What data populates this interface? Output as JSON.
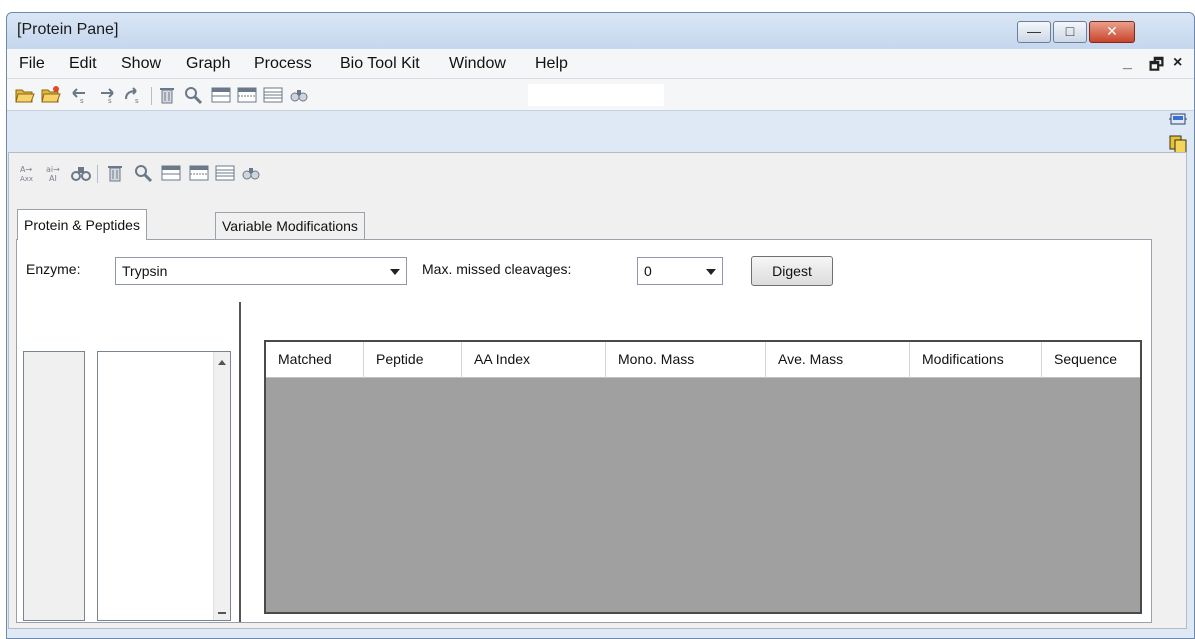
{
  "window": {
    "title": "[Protein Pane]",
    "controls": [
      "minimize",
      "maximize",
      "close"
    ]
  },
  "menubar": {
    "items": [
      "File",
      "Edit",
      "Show",
      "Graph",
      "Process",
      "Bio Tool Kit",
      "Window",
      "Help"
    ],
    "mdi_controls": [
      "_",
      "🗗",
      "×"
    ]
  },
  "toolbar": {
    "icons": [
      "open-folder-icon",
      "open-folder-star-icon",
      "undo-icon",
      "redo-icon",
      "redo-all-icon",
      "trash-icon",
      "magnify-icon",
      "table-icon",
      "table-icon",
      "table-lines-icon",
      "binoculars-icon"
    ],
    "search_value": ""
  },
  "pane_toolbar": {
    "icons": [
      "aa-arrow-icon",
      "ai-arrow-icon",
      "binoculars-icon",
      "trash-icon",
      "magnify-icon",
      "table-icon",
      "table-icon",
      "table-lines-icon",
      "binoculars-small-icon"
    ]
  },
  "tabs": {
    "protein_peptides": "Protein & Peptides",
    "variable_mods": "Variable Modifications"
  },
  "digest": {
    "enzyme_label": "Enzyme:",
    "enzyme_value": "Trypsin",
    "missed_label": "Max. missed cleavages:",
    "missed_value": "0",
    "digest_button": "Digest"
  },
  "table": {
    "columns": [
      "Matched",
      "Peptide",
      "AA Index",
      "Mono. Mass",
      "Ave. Mass",
      "Modifications",
      "Sequence"
    ],
    "rows": []
  },
  "colors": {
    "grid_background": "#a0a0a0",
    "window_frame": "#dfe9f5",
    "close_button": "#c8452c"
  }
}
